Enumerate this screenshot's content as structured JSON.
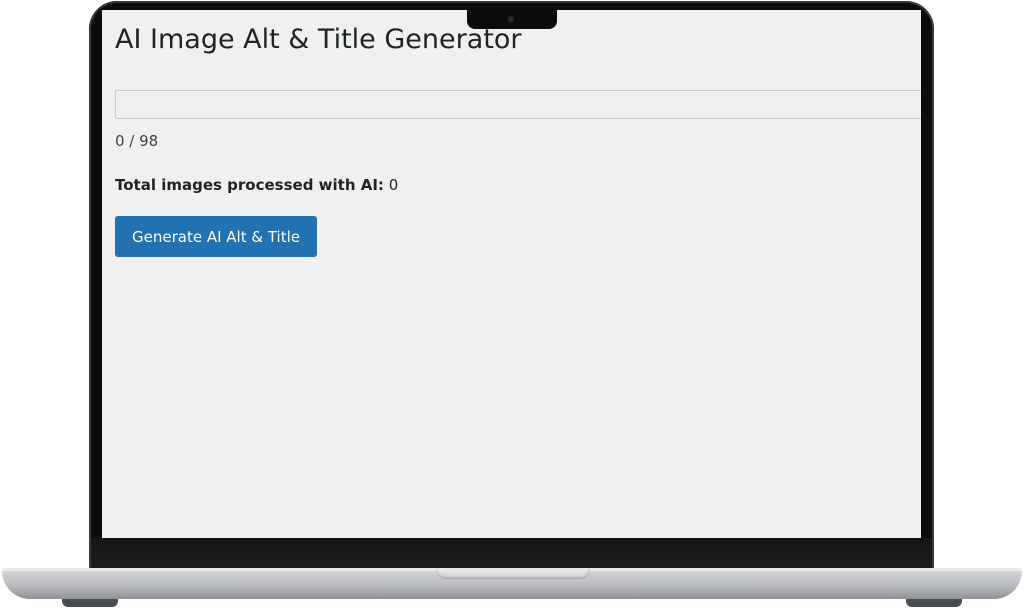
{
  "page": {
    "title": "AI Image Alt & Title Generator"
  },
  "progress": {
    "fraction": 0,
    "count_text": "0 / 98"
  },
  "stats": {
    "processed_label": "Total images processed with AI:",
    "processed_value": "0"
  },
  "actions": {
    "generate_label": "Generate AI Alt & Title"
  },
  "colors": {
    "accent": "#2271b1",
    "screen_bg": "#f0f0f1",
    "text": "#1d2327"
  }
}
